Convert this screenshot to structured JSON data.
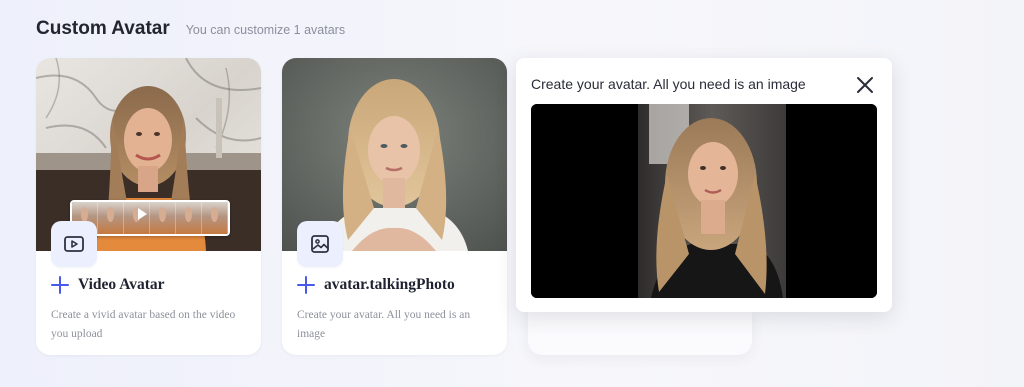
{
  "header": {
    "title": "Custom Avatar",
    "subtitle": "You can customize 1 avatars"
  },
  "cards": [
    {
      "title": "Video Avatar",
      "description": "Create a vivid avatar based on the video you upload",
      "icon": "video-play-icon"
    },
    {
      "title": "avatar.talkingPhoto",
      "description": "Create your avatar. All you need is an image",
      "icon": "image-icon"
    }
  ],
  "modal": {
    "title": "Create your avatar. All you need is an image",
    "close_icon": "close-icon"
  },
  "colors": {
    "accent": "#4a5ae8",
    "badge_bg": "#eceffd",
    "title_text": "#23262f",
    "muted_text": "#8b8f9c"
  }
}
